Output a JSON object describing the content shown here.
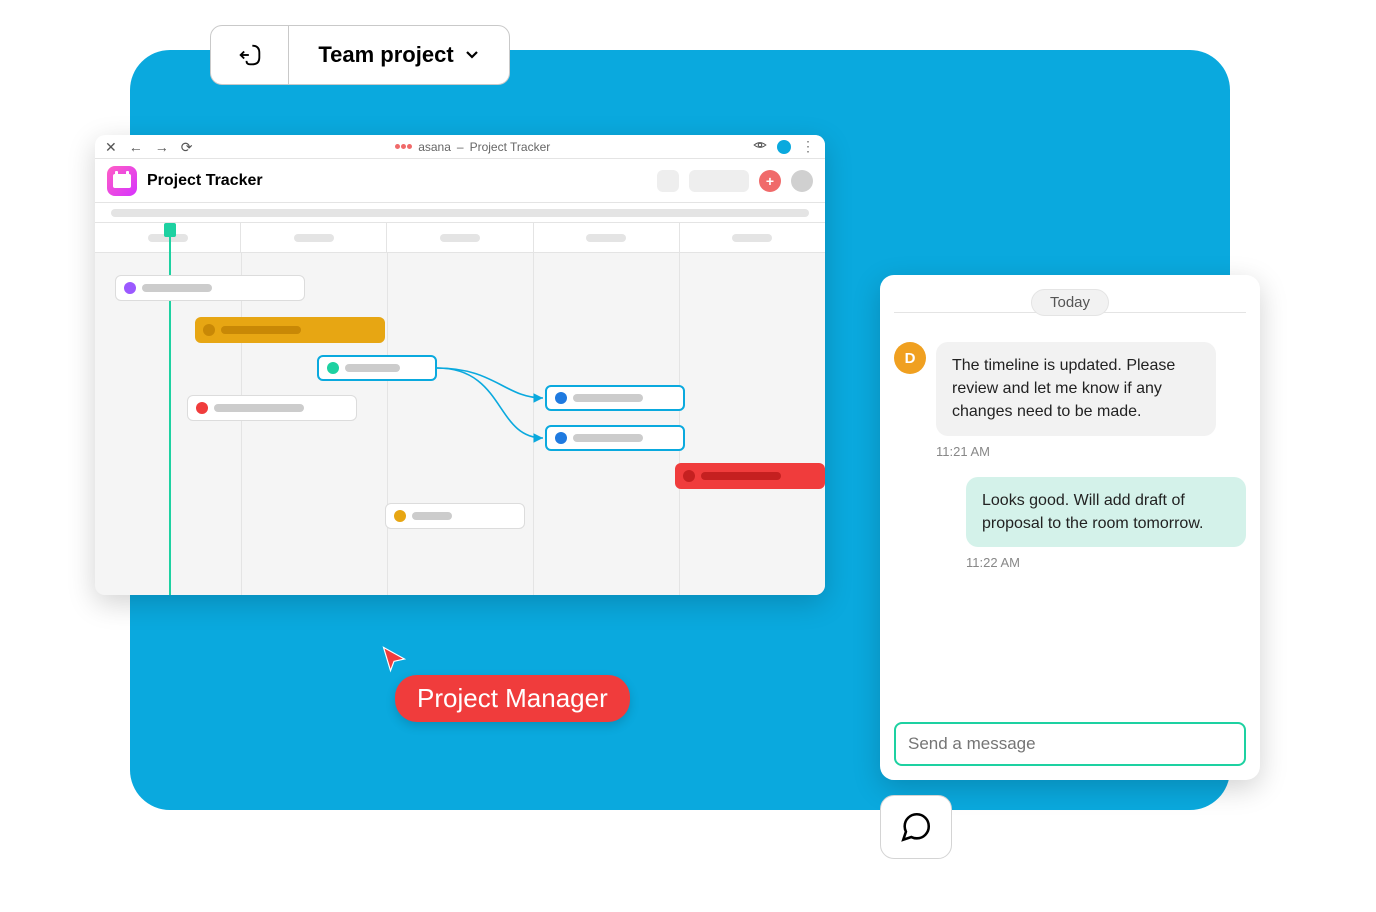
{
  "top_selector": {
    "label": "Team project"
  },
  "browser": {
    "app_name": "asana",
    "separator": "–",
    "tab_title": "Project Tracker",
    "project_title": "Project Tracker"
  },
  "cursor_badge": "Project Manager",
  "chat": {
    "today_label": "Today",
    "avatar_initial": "D",
    "messages": [
      {
        "author": "other",
        "text": "The timeline is updated. Please review and let me know if any changes need to be made.",
        "time": "11:21 AM"
      },
      {
        "author": "self",
        "text": "Looks good. Will add draft of proposal to the room tomorrow.",
        "time": "11:22 AM"
      }
    ],
    "input_placeholder": "Send a message"
  },
  "colors": {
    "bg_blue": "#0aa9de",
    "teal": "#1dd1a1",
    "amber": "#e7a613",
    "red": "#f03c3c",
    "purple": "#9b59ff",
    "blue_dot": "#1f7ae0",
    "red_dot": "#f03c3c"
  }
}
